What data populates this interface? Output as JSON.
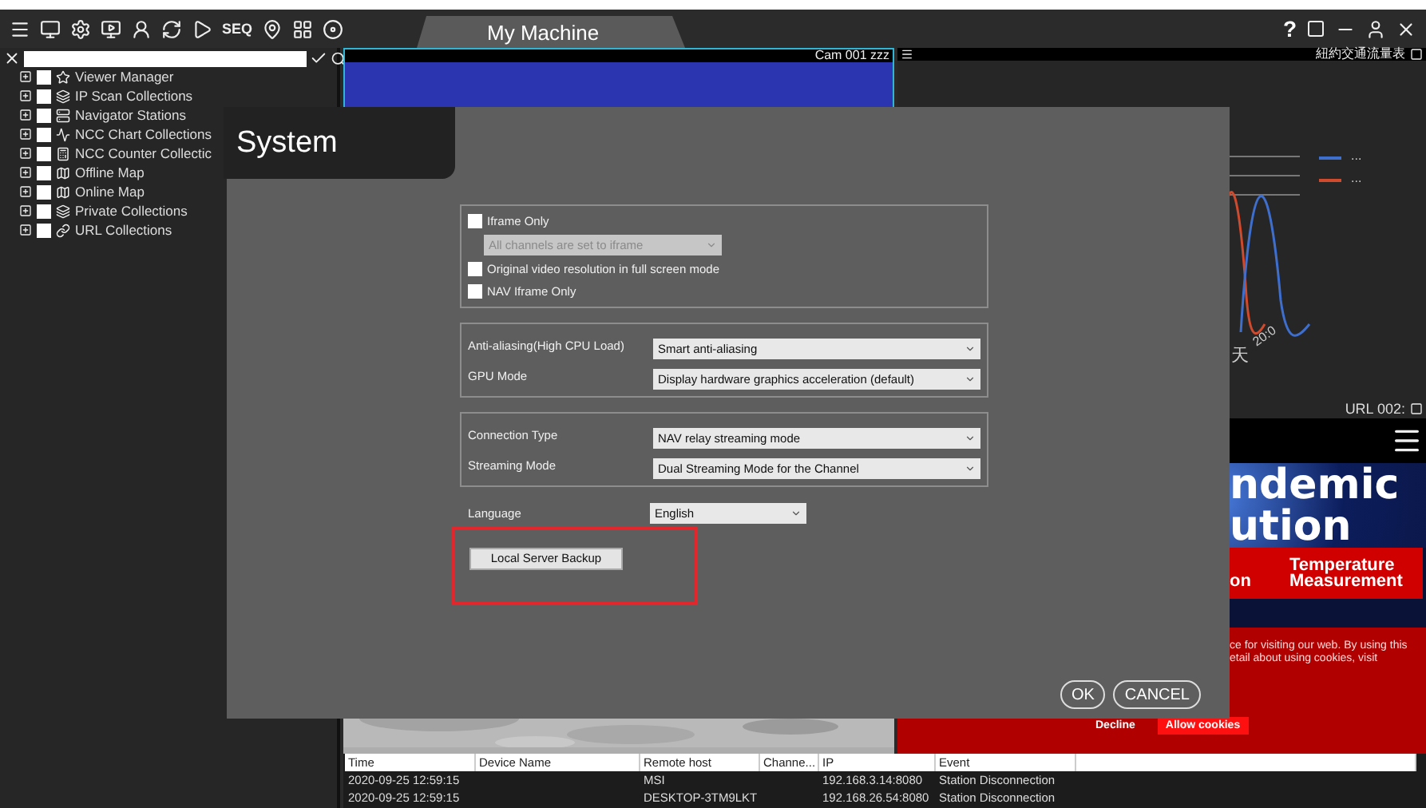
{
  "toolbar": {
    "seq_label": "SEQ"
  },
  "tabs": [
    {
      "label": "My Machine",
      "selected": true
    }
  ],
  "window_controls": {
    "help": "?"
  },
  "sidebar": {
    "items": [
      {
        "label": "Viewer Manager",
        "kind": "star",
        "checked": false,
        "expanded": false
      },
      {
        "label": "IP Scan Collections",
        "kind": "collection",
        "checked": false,
        "expanded": false
      },
      {
        "label": "Navigator Stations",
        "kind": "stations",
        "checked": false,
        "expanded": false
      },
      {
        "label": "NCC Chart Collections",
        "kind": "chart",
        "checked": false,
        "expanded": false
      },
      {
        "label": "NCC Counter Collectic",
        "kind": "counter",
        "checked": false,
        "expanded": false
      },
      {
        "label": "Offline Map",
        "kind": "map",
        "checked": false,
        "expanded": false
      },
      {
        "label": "Online Map",
        "kind": "map",
        "checked": false,
        "expanded": false
      },
      {
        "label": "Private Collections",
        "kind": "collection",
        "checked": false,
        "expanded": false
      },
      {
        "label": "URL Collections",
        "kind": "link",
        "checked": false,
        "expanded": false
      }
    ]
  },
  "panels": {
    "camera": {
      "title": "Cam 001 zzz"
    },
    "chart": {
      "title": "紐約交通流量表",
      "legend": [
        {
          "label": "...",
          "color": "#3f6fce"
        },
        {
          "label": "...",
          "color": "#d04a2e"
        }
      ],
      "axis_labels": [
        "20:0",
        "天"
      ]
    },
    "url": {
      "title": "URL 002:",
      "headline": [
        "ndemic",
        "ution"
      ],
      "banner_cut": "on",
      "banner_lines": [
        "Temperature",
        "Measurement"
      ],
      "cookie_lines": [
        "ce for visiting our web. By using this",
        "etail about using cookies, visit"
      ],
      "cookie_buttons": [
        {
          "label": "Decline",
          "kind": "text"
        },
        {
          "label": "Allow cookies",
          "kind": "filled"
        }
      ]
    }
  },
  "dialog": {
    "title": "System",
    "iframe_only": {
      "label": "Iframe Only",
      "checked": false
    },
    "iframe_select": {
      "value": "All channels are set to iframe",
      "disabled": true
    },
    "options": [
      {
        "label": "Original video resolution in full screen mode",
        "checked": false
      },
      {
        "label": "NAV Iframe Only",
        "checked": false
      }
    ],
    "groups": [
      {
        "fields": [
          {
            "label": "Anti-aliasing(High CPU Load)",
            "value": "Smart anti-aliasing"
          },
          {
            "label": "GPU Mode",
            "value": "Display hardware graphics acceleration (default)"
          }
        ]
      },
      {
        "fields": [
          {
            "label": "Connection Type",
            "value": "NAV relay streaming mode"
          },
          {
            "label": "Streaming Mode",
            "value": "Dual Streaming Mode for the Channel"
          }
        ]
      }
    ],
    "language": {
      "label": "Language",
      "value": "English"
    },
    "backup_button": "Local Server Backup",
    "backup_highlighted": true,
    "buttons": [
      "OK",
      "CANCEL"
    ]
  },
  "event_log": {
    "columns": [
      "Time",
      "Device Name",
      "Remote host",
      "Channe...",
      "IP",
      "Event"
    ],
    "rows": [
      [
        "2020-09-25 12:59:15",
        "",
        "MSI",
        "",
        "192.168.3.14:8080",
        "Station Disconnection"
      ],
      [
        "2020-09-25 12:59:15",
        "",
        "DESKTOP-3TM9LKT",
        "",
        "192.168.26.54:8080",
        "Station Disconnection"
      ]
    ]
  }
}
